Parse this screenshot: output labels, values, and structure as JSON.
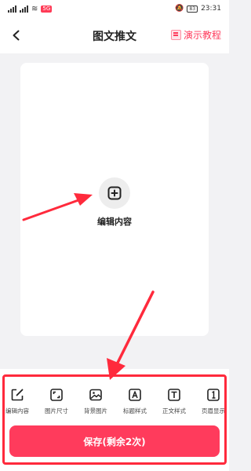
{
  "status_bar": {
    "net_badge": "5G",
    "battery": "83",
    "time": "23:31"
  },
  "nav": {
    "title": "图文推文",
    "tutorial_label": "演示教程"
  },
  "canvas": {
    "edit_label": "编辑内容"
  },
  "toolbar": {
    "tools": [
      {
        "label": "编辑内容",
        "icon": "edit-icon"
      },
      {
        "label": "图片尺寸",
        "icon": "resize-icon"
      },
      {
        "label": "背景图片",
        "icon": "image-icon"
      },
      {
        "label": "标题样式",
        "icon": "title-style-icon"
      },
      {
        "label": "正文样式",
        "icon": "body-style-icon"
      },
      {
        "label": "页眉显示",
        "icon": "header-icon"
      }
    ]
  },
  "save": {
    "label": "保存(剩余2次)"
  },
  "colors": {
    "accent": "#ff3b5c",
    "annotation": "#ff2a3c",
    "background": "#f2f2f4"
  }
}
